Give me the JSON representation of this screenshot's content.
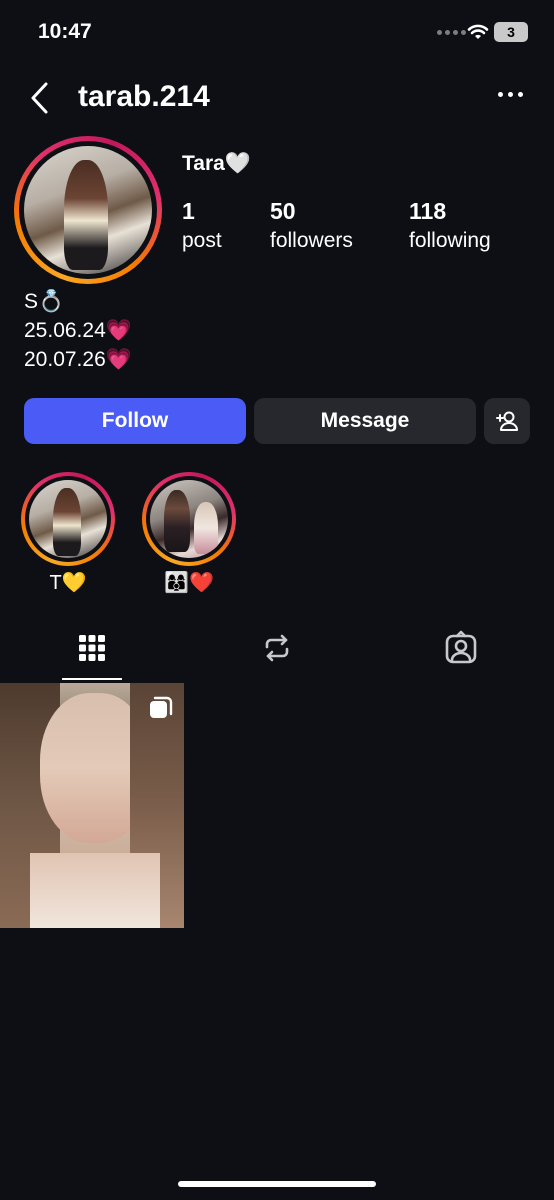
{
  "status_bar": {
    "time": "10:47",
    "battery": "3"
  },
  "header": {
    "username": "tarab.214"
  },
  "profile": {
    "display_name": "Tara🤍",
    "stats": [
      {
        "value": "1",
        "label": "post"
      },
      {
        "value": "50",
        "label": "followers"
      },
      {
        "value": "118",
        "label": "following"
      }
    ],
    "bio": [
      "S💍",
      "25.06.24💗",
      "20.07.26💗"
    ]
  },
  "actions": {
    "follow": "Follow",
    "message": "Message"
  },
  "highlights": [
    {
      "label": "T💛"
    },
    {
      "label": "👩‍👩‍👦❤️"
    }
  ],
  "tabs": [
    "grid-icon",
    "reposts-icon",
    "tagged-icon"
  ],
  "colors": {
    "follow": "#4a5cf5",
    "background": "#0d0f14",
    "button": "#26282e"
  }
}
